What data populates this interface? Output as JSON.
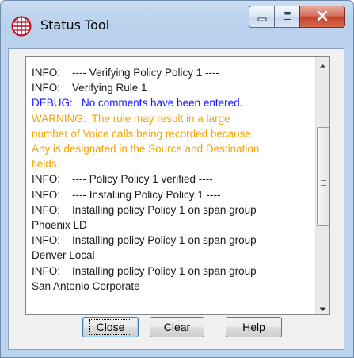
{
  "window": {
    "title": "Status Tool",
    "icon": "globe-grid-icon",
    "controls": {
      "minimize_icon": "minimize-icon",
      "maximize_icon": "maximize-icon",
      "close_icon": "close-x-icon"
    }
  },
  "log": {
    "lines": [
      {
        "level": "info",
        "text": "INFO:    ---- Verifying Policy Policy 1 ----"
      },
      {
        "level": "info",
        "text": "INFO:    Verifying Rule 1"
      },
      {
        "level": "debug",
        "text": "DEBUG:   No comments have been entered."
      },
      {
        "level": "warning",
        "text": "WARNING:  The rule may result in a large"
      },
      {
        "level": "warning",
        "text": "number of Voice calls being recorded because"
      },
      {
        "level": "warning",
        "text": "Any is designated in the Source and Destination"
      },
      {
        "level": "warning",
        "text": "fields."
      },
      {
        "level": "info",
        "text": "INFO:    ---- Policy Policy 1 verified ----"
      },
      {
        "level": "info",
        "text": "INFO:    ---- Installing Policy Policy 1 ----"
      },
      {
        "level": "info",
        "text": "INFO:    Installing policy Policy 1 on span group"
      },
      {
        "level": "info",
        "text": "Phoenix LD"
      },
      {
        "level": "info",
        "text": "INFO:    Installing policy Policy 1 on span group"
      },
      {
        "level": "info",
        "text": "Denver Local"
      },
      {
        "level": "info",
        "text": "INFO:    Installing policy Policy 1 on span group"
      },
      {
        "level": "info",
        "text": "San Antonio Corporate"
      }
    ],
    "colors": {
      "info": "#1a1a1a",
      "debug": "#1515ff",
      "warning": "#f5a300"
    }
  },
  "buttons": {
    "close_label": "Close",
    "clear_label": "Clear",
    "help_label": "Help"
  }
}
